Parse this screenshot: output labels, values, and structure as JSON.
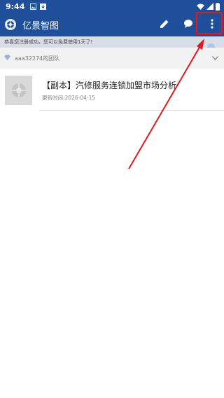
{
  "status_bar": {
    "time": "9:44"
  },
  "app_bar": {
    "title": "亿景智图",
    "icons": [
      "app-logo-icon",
      "edit-icon",
      "chat-icon",
      "more-vertical-icon"
    ]
  },
  "notice": {
    "text": "恭喜您注册成功，您可以免费使用1天了!"
  },
  "team": {
    "label": "aaa32274的团队"
  },
  "list": {
    "items": [
      {
        "title": "【副本】汽修服务连锁加盟市场分析",
        "date": "更新时间:2026-04-15"
      }
    ]
  },
  "colors": {
    "primary": "#1f4e9a",
    "highlight": "#e0191f"
  }
}
